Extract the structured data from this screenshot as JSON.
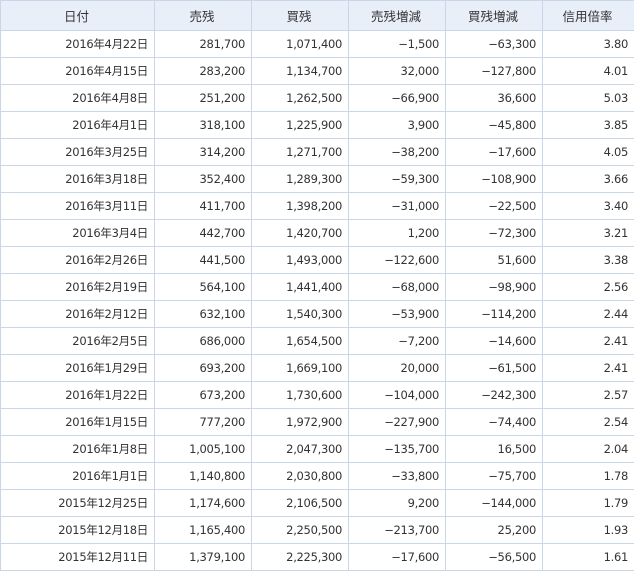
{
  "table": {
    "headers": [
      "日付",
      "売残",
      "買残",
      "売残増減",
      "買残増減",
      "信用倍率"
    ],
    "rows": [
      [
        "2016年4月22日",
        "281,700",
        "1,071,400",
        "−1,500",
        "−63,300",
        "3.80"
      ],
      [
        "2016年4月15日",
        "283,200",
        "1,134,700",
        "32,000",
        "−127,800",
        "4.01"
      ],
      [
        "2016年4月8日",
        "251,200",
        "1,262,500",
        "−66,900",
        "36,600",
        "5.03"
      ],
      [
        "2016年4月1日",
        "318,100",
        "1,225,900",
        "3,900",
        "−45,800",
        "3.85"
      ],
      [
        "2016年3月25日",
        "314,200",
        "1,271,700",
        "−38,200",
        "−17,600",
        "4.05"
      ],
      [
        "2016年3月18日",
        "352,400",
        "1,289,300",
        "−59,300",
        "−108,900",
        "3.66"
      ],
      [
        "2016年3月11日",
        "411,700",
        "1,398,200",
        "−31,000",
        "−22,500",
        "3.40"
      ],
      [
        "2016年3月4日",
        "442,700",
        "1,420,700",
        "1,200",
        "−72,300",
        "3.21"
      ],
      [
        "2016年2月26日",
        "441,500",
        "1,493,000",
        "−122,600",
        "51,600",
        "3.38"
      ],
      [
        "2016年2月19日",
        "564,100",
        "1,441,400",
        "−68,000",
        "−98,900",
        "2.56"
      ],
      [
        "2016年2月12日",
        "632,100",
        "1,540,300",
        "−53,900",
        "−114,200",
        "2.44"
      ],
      [
        "2016年2月5日",
        "686,000",
        "1,654,500",
        "−7,200",
        "−14,600",
        "2.41"
      ],
      [
        "2016年1月29日",
        "693,200",
        "1,669,100",
        "20,000",
        "−61,500",
        "2.41"
      ],
      [
        "2016年1月22日",
        "673,200",
        "1,730,600",
        "−104,000",
        "−242,300",
        "2.57"
      ],
      [
        "2016年1月15日",
        "777,200",
        "1,972,900",
        "−227,900",
        "−74,400",
        "2.54"
      ],
      [
        "2016年1月8日",
        "1,005,100",
        "2,047,300",
        "−135,700",
        "16,500",
        "2.04"
      ],
      [
        "2016年1月1日",
        "1,140,800",
        "2,030,800",
        "−33,800",
        "−75,700",
        "1.78"
      ],
      [
        "2015年12月25日",
        "1,174,600",
        "2,106,500",
        "9,200",
        "−144,000",
        "1.79"
      ],
      [
        "2015年12月18日",
        "1,165,400",
        "2,250,500",
        "−213,700",
        "25,200",
        "1.93"
      ],
      [
        "2015年12月11日",
        "1,379,100",
        "2,225,300",
        "−17,600",
        "−56,500",
        "1.61"
      ]
    ]
  },
  "colors": {
    "header_background": "#e8eff9",
    "border": "#c9d6e8",
    "text": "#333333"
  }
}
